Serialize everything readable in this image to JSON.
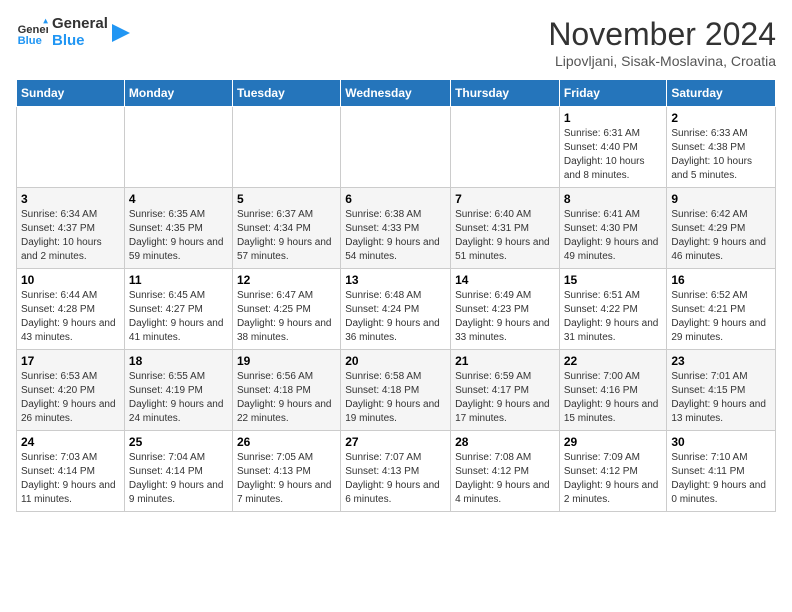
{
  "logo": {
    "text_general": "General",
    "text_blue": "Blue"
  },
  "header": {
    "title": "November 2024",
    "subtitle": "Lipovljani, Sisak-Moslavina, Croatia"
  },
  "days_of_week": [
    "Sunday",
    "Monday",
    "Tuesday",
    "Wednesday",
    "Thursday",
    "Friday",
    "Saturday"
  ],
  "weeks": [
    [
      {
        "day": "",
        "info": ""
      },
      {
        "day": "",
        "info": ""
      },
      {
        "day": "",
        "info": ""
      },
      {
        "day": "",
        "info": ""
      },
      {
        "day": "",
        "info": ""
      },
      {
        "day": "1",
        "info": "Sunrise: 6:31 AM\nSunset: 4:40 PM\nDaylight: 10 hours and 8 minutes."
      },
      {
        "day": "2",
        "info": "Sunrise: 6:33 AM\nSunset: 4:38 PM\nDaylight: 10 hours and 5 minutes."
      }
    ],
    [
      {
        "day": "3",
        "info": "Sunrise: 6:34 AM\nSunset: 4:37 PM\nDaylight: 10 hours and 2 minutes."
      },
      {
        "day": "4",
        "info": "Sunrise: 6:35 AM\nSunset: 4:35 PM\nDaylight: 9 hours and 59 minutes."
      },
      {
        "day": "5",
        "info": "Sunrise: 6:37 AM\nSunset: 4:34 PM\nDaylight: 9 hours and 57 minutes."
      },
      {
        "day": "6",
        "info": "Sunrise: 6:38 AM\nSunset: 4:33 PM\nDaylight: 9 hours and 54 minutes."
      },
      {
        "day": "7",
        "info": "Sunrise: 6:40 AM\nSunset: 4:31 PM\nDaylight: 9 hours and 51 minutes."
      },
      {
        "day": "8",
        "info": "Sunrise: 6:41 AM\nSunset: 4:30 PM\nDaylight: 9 hours and 49 minutes."
      },
      {
        "day": "9",
        "info": "Sunrise: 6:42 AM\nSunset: 4:29 PM\nDaylight: 9 hours and 46 minutes."
      }
    ],
    [
      {
        "day": "10",
        "info": "Sunrise: 6:44 AM\nSunset: 4:28 PM\nDaylight: 9 hours and 43 minutes."
      },
      {
        "day": "11",
        "info": "Sunrise: 6:45 AM\nSunset: 4:27 PM\nDaylight: 9 hours and 41 minutes."
      },
      {
        "day": "12",
        "info": "Sunrise: 6:47 AM\nSunset: 4:25 PM\nDaylight: 9 hours and 38 minutes."
      },
      {
        "day": "13",
        "info": "Sunrise: 6:48 AM\nSunset: 4:24 PM\nDaylight: 9 hours and 36 minutes."
      },
      {
        "day": "14",
        "info": "Sunrise: 6:49 AM\nSunset: 4:23 PM\nDaylight: 9 hours and 33 minutes."
      },
      {
        "day": "15",
        "info": "Sunrise: 6:51 AM\nSunset: 4:22 PM\nDaylight: 9 hours and 31 minutes."
      },
      {
        "day": "16",
        "info": "Sunrise: 6:52 AM\nSunset: 4:21 PM\nDaylight: 9 hours and 29 minutes."
      }
    ],
    [
      {
        "day": "17",
        "info": "Sunrise: 6:53 AM\nSunset: 4:20 PM\nDaylight: 9 hours and 26 minutes."
      },
      {
        "day": "18",
        "info": "Sunrise: 6:55 AM\nSunset: 4:19 PM\nDaylight: 9 hours and 24 minutes."
      },
      {
        "day": "19",
        "info": "Sunrise: 6:56 AM\nSunset: 4:18 PM\nDaylight: 9 hours and 22 minutes."
      },
      {
        "day": "20",
        "info": "Sunrise: 6:58 AM\nSunset: 4:18 PM\nDaylight: 9 hours and 19 minutes."
      },
      {
        "day": "21",
        "info": "Sunrise: 6:59 AM\nSunset: 4:17 PM\nDaylight: 9 hours and 17 minutes."
      },
      {
        "day": "22",
        "info": "Sunrise: 7:00 AM\nSunset: 4:16 PM\nDaylight: 9 hours and 15 minutes."
      },
      {
        "day": "23",
        "info": "Sunrise: 7:01 AM\nSunset: 4:15 PM\nDaylight: 9 hours and 13 minutes."
      }
    ],
    [
      {
        "day": "24",
        "info": "Sunrise: 7:03 AM\nSunset: 4:14 PM\nDaylight: 9 hours and 11 minutes."
      },
      {
        "day": "25",
        "info": "Sunrise: 7:04 AM\nSunset: 4:14 PM\nDaylight: 9 hours and 9 minutes."
      },
      {
        "day": "26",
        "info": "Sunrise: 7:05 AM\nSunset: 4:13 PM\nDaylight: 9 hours and 7 minutes."
      },
      {
        "day": "27",
        "info": "Sunrise: 7:07 AM\nSunset: 4:13 PM\nDaylight: 9 hours and 6 minutes."
      },
      {
        "day": "28",
        "info": "Sunrise: 7:08 AM\nSunset: 4:12 PM\nDaylight: 9 hours and 4 minutes."
      },
      {
        "day": "29",
        "info": "Sunrise: 7:09 AM\nSunset: 4:12 PM\nDaylight: 9 hours and 2 minutes."
      },
      {
        "day": "30",
        "info": "Sunrise: 7:10 AM\nSunset: 4:11 PM\nDaylight: 9 hours and 0 minutes."
      }
    ]
  ]
}
